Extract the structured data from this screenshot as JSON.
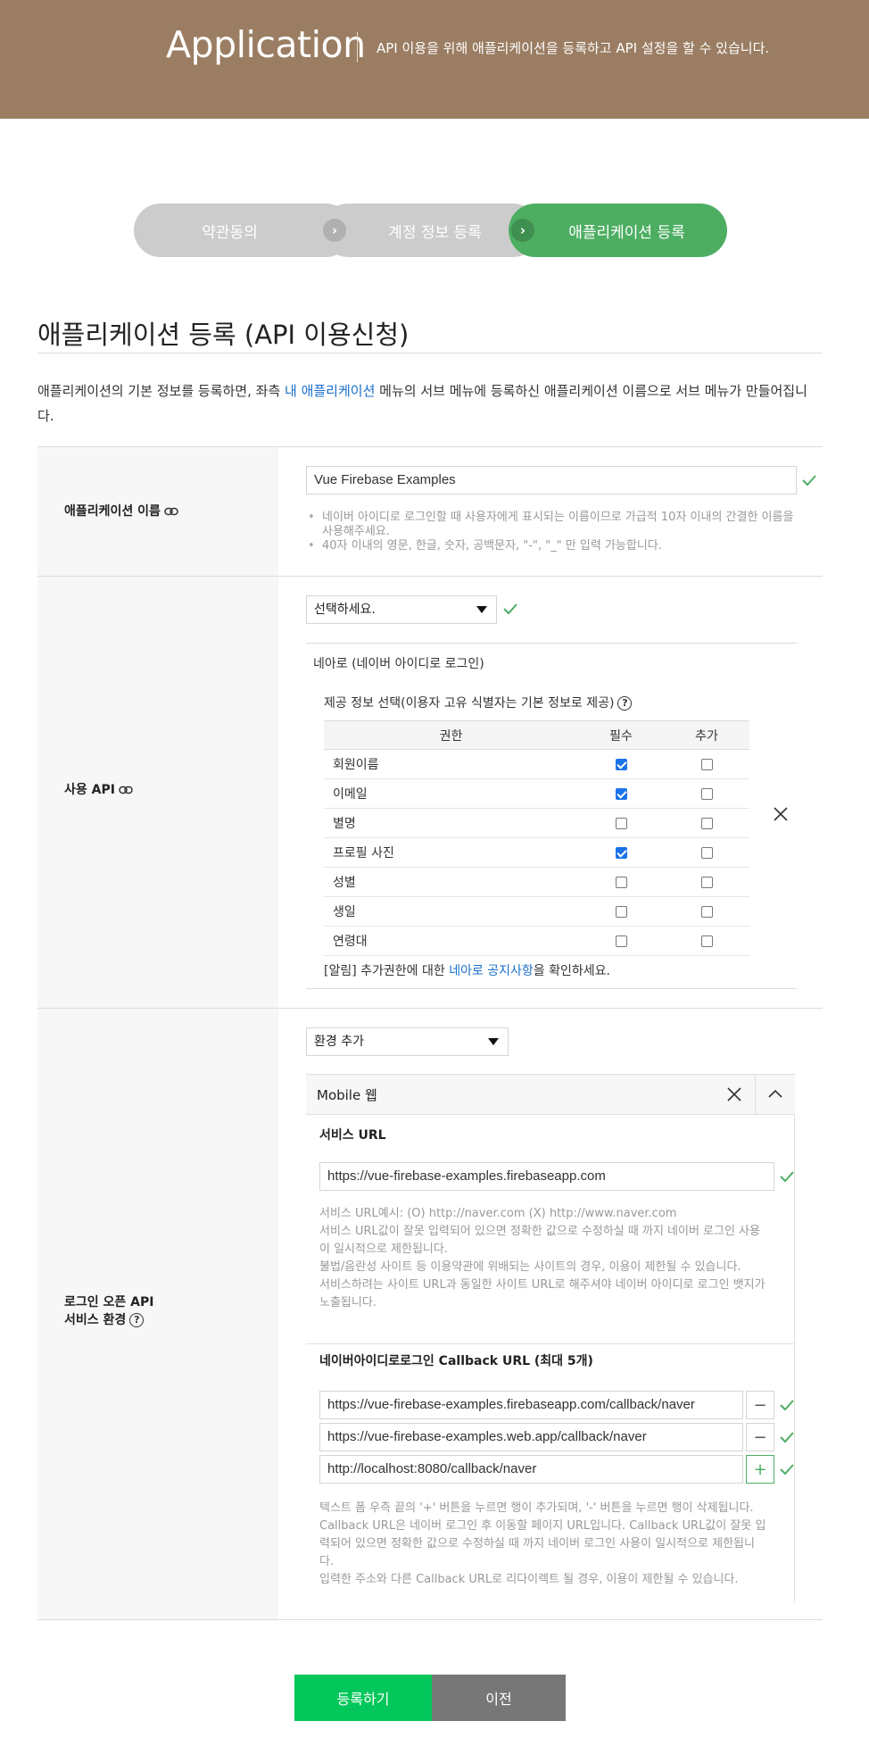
{
  "header": {
    "title": "Application",
    "description": "API 이용을 위해 애플리케이션을 등록하고 API 설정을 할 수 있습니다."
  },
  "steps": [
    {
      "label": "약관동의",
      "state": "done"
    },
    {
      "label": "계정 정보 등록",
      "state": "done"
    },
    {
      "label": "애플리케이션 등록",
      "state": "current"
    }
  ],
  "step_arrow": "›",
  "page_title": "애플리케이션 등록 (API 이용신청)",
  "intro": {
    "before": "애플리케이션의 기본 정보를 등록하면, 좌측 ",
    "link": "내 애플리케이션",
    "after": " 메뉴의 서브 메뉴에 등록하신 애플리케이션 이름으로 서브 메뉴가 만들어집니다."
  },
  "app_name": {
    "label": "애플리케이션 이름",
    "value": "Vue Firebase Examples",
    "notes": [
      "네이버 아이디로 로그인할 때 사용자에게 표시되는 이름이므로 가급적 10자 이내의 간결한 이름을 사용해주세요.",
      "40자 이내의 영문, 한글, 숫자, 공백문자, \"-\", \"_\" 만 입력 가능합니다."
    ]
  },
  "api": {
    "label": "사용 API",
    "select_value": "선택하세요.",
    "selected_api": "네아로 (네이버 아이디로 로그인)",
    "perm_title": "제공 정보 선택(이용자 고유 식별자는 기본 정보로 제공)",
    "columns": [
      "권한",
      "필수",
      "추가"
    ],
    "permissions": [
      {
        "name": "회원이름",
        "required": true,
        "optional": false
      },
      {
        "name": "이메일",
        "required": true,
        "optional": false
      },
      {
        "name": "별명",
        "required": false,
        "optional": false
      },
      {
        "name": "프로필 사진",
        "required": true,
        "optional": false
      },
      {
        "name": "성별",
        "required": false,
        "optional": false
      },
      {
        "name": "생일",
        "required": false,
        "optional": false
      },
      {
        "name": "연령대",
        "required": false,
        "optional": false
      }
    ],
    "notice_before": "[알림] 추가권한에 대한 ",
    "notice_link": "네아로 공지사항",
    "notice_after": "을 확인하세요."
  },
  "env": {
    "label_line1": "로그인 오픈 API",
    "label_line2": "서비스 환경",
    "select_value": "환경 추가",
    "panel_title": "Mobile 웹",
    "service_url_label": "서비스 URL",
    "service_url": "https://vue-firebase-examples.firebaseapp.com",
    "service_url_hints": [
      "서비스 URL예시: (O) http://naver.com (X) http://www.naver.com",
      "서비스 URL값이 잘못 입력되어 있으면 정확한 값으로 수정하실 때 까지 네이버 로그인 사용",
      "이 일시적으로 제한됩니다.",
      "불법/음란성 사이트 등 이용약관에 위배되는 사이트의 경우, 이용이 제한될 수 있습니다.",
      "서비스하려는 사이트 URL과 동일한 사이트 URL로 해주셔야 네이버 아이디로 로그인 뱃지가",
      "노출됩니다."
    ],
    "callback_label": "네이버아이디로로그인 Callback URL (최대 5개)",
    "callbacks": [
      "https://vue-firebase-examples.firebaseapp.com/callback/naver",
      "https://vue-firebase-examples.web.app/callback/naver",
      "http://localhost:8080/callback/naver"
    ],
    "minus": "−",
    "plus": "+",
    "callback_hints": [
      "텍스트 폼 우측 끝의 '+' 버튼을 누르면 행이 추가되며, '-' 버튼을 누르면 행이 삭제됩니다.",
      "Callback URL은 네이버 로그인 후 이동할 페이지 URL입니다. Callback URL값이 잘못 입",
      "력되어 있으면 정확한 값으로 수정하실 때 까지 네이버 로그인 사용이 일시적으로 제한됩니",
      "다.",
      "입력한 주소와 다른 Callback URL로 리다이렉트 될 경우, 이용이 제한될 수 있습니다."
    ]
  },
  "help_glyph": "?",
  "buttons": {
    "submit": "등록하기",
    "prev": "이전"
  },
  "colors": {
    "header_bg": "#9a7d62",
    "step_active": "#4dae62",
    "step_inactive": "#cccccc",
    "submit": "#03c75a",
    "link": "#1a6fc9",
    "check": "#4dae62"
  }
}
